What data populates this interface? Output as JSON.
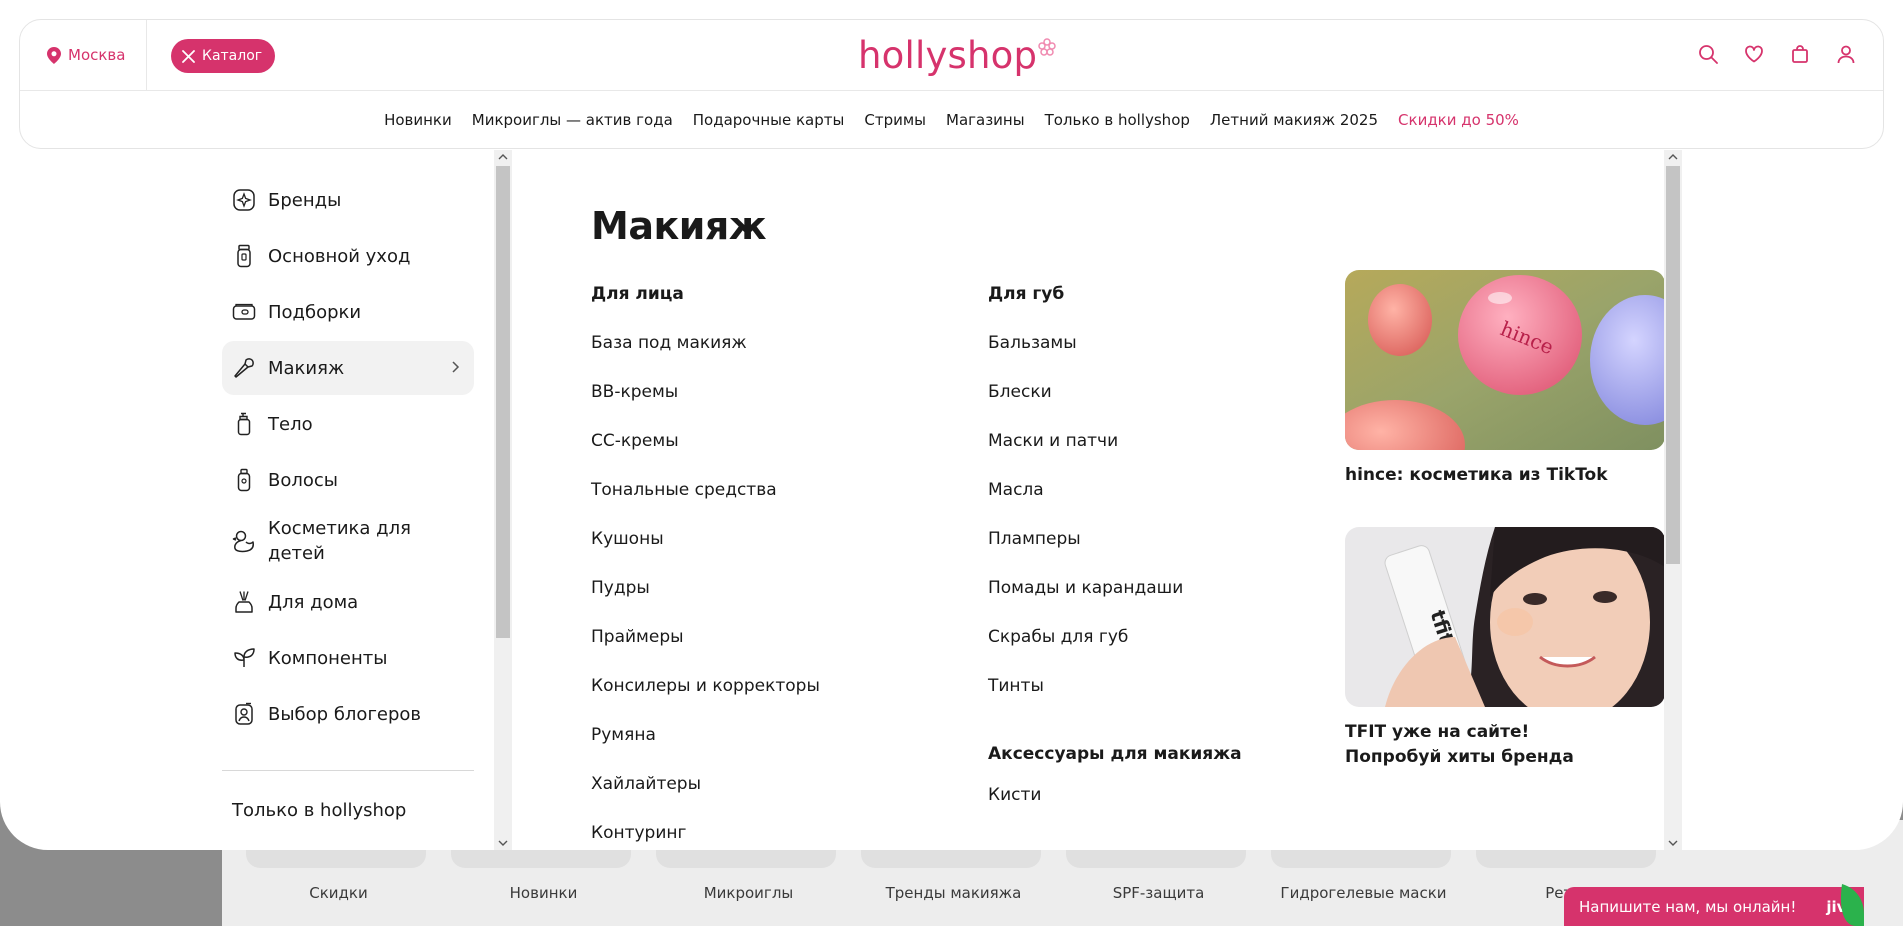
{
  "header": {
    "city": "Москва",
    "catalog_label": "Каталог",
    "logo": "hollyshop",
    "nav": [
      "Новинки",
      "Микроиглы — актив года",
      "Подарочные карты",
      "Стримы",
      "Магазины",
      "Только в hollyshop",
      "Летний макияж 2025",
      "Скидки до 50%"
    ]
  },
  "sidebar": {
    "items": [
      {
        "label": "Бренды",
        "icon": "brands-icon"
      },
      {
        "label": "Основной уход",
        "icon": "skincare-bottle-icon"
      },
      {
        "label": "Подборки",
        "icon": "collections-icon"
      },
      {
        "label": "Макияж",
        "icon": "makeup-brush-icon"
      },
      {
        "label": "Тело",
        "icon": "body-lotion-icon"
      },
      {
        "label": "Волосы",
        "icon": "hair-bottle-icon"
      },
      {
        "label": "Косметика для детей",
        "icon": "kids-duck-icon"
      },
      {
        "label": "Для дома",
        "icon": "home-diffuser-icon"
      },
      {
        "label": "Компоненты",
        "icon": "leaf-icon"
      },
      {
        "label": "Выбор блогеров",
        "icon": "blogger-icon"
      }
    ],
    "only_in": "Только в hollyshop"
  },
  "content": {
    "title": "Макияж",
    "face": {
      "heading": "Для лица",
      "links": [
        "База под макияж",
        "BB-кремы",
        "CC-кремы",
        "Тональные средства",
        "Кушоны",
        "Пудры",
        "Праймеры",
        "Консилеры и корректоры",
        "Румяна",
        "Хайлайтеры",
        "Контуринг"
      ]
    },
    "lips": {
      "heading": "Для губ",
      "links": [
        "Бальзамы",
        "Блески",
        "Маски и патчи",
        "Масла",
        "Пламперы",
        "Помады и карандаши",
        "Скрабы для губ",
        "Тинты"
      ],
      "accessories_heading": "Аксессуары для макияжа",
      "accessories": [
        "Кисти"
      ]
    },
    "promos": [
      {
        "caption": "hince: косметика из TikTok",
        "brand_text": "hince"
      },
      {
        "caption": "TFIT уже на сайте!\nПопробуй хиты бренда",
        "brand_text": "tfit"
      }
    ]
  },
  "background_categories": [
    "Скидки",
    "Новинки",
    "Микроиглы",
    "Тренды макияжа",
    "SPF-защита",
    "Гидрогелевые маски",
    "Ретин"
  ],
  "chat": {
    "label": "Напишите нам, мы онлайн!",
    "brand": "jivo"
  },
  "colors": {
    "accent": "#d6336c",
    "active_bg": "#f2f2f2",
    "overlay_dim": "#8c8c8c"
  }
}
